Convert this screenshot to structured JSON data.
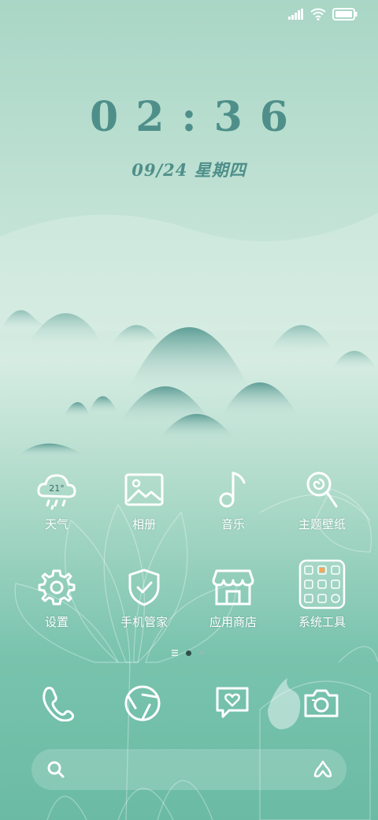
{
  "status": {
    "icons": [
      "signal-icon",
      "wifi-icon",
      "battery-icon"
    ]
  },
  "clock": {
    "time": "02:36",
    "date": "09/24 星期四"
  },
  "apps": [
    {
      "name": "weather",
      "label": "天气",
      "temp": "21°"
    },
    {
      "name": "gallery",
      "label": "相册"
    },
    {
      "name": "music",
      "label": "音乐"
    },
    {
      "name": "themes",
      "label": "主题壁纸"
    },
    {
      "name": "settings",
      "label": "设置"
    },
    {
      "name": "security",
      "label": "手机管家"
    },
    {
      "name": "app-store",
      "label": "应用商店"
    },
    {
      "name": "system-tools",
      "label": "系统工具"
    }
  ],
  "dock": [
    "phone-icon",
    "browser-icon",
    "messages-icon",
    "camera-icon"
  ],
  "page_indicator": {
    "pages": 2,
    "current": 1
  },
  "search": {
    "icons": [
      "search-icon",
      "assistant-icon"
    ]
  }
}
